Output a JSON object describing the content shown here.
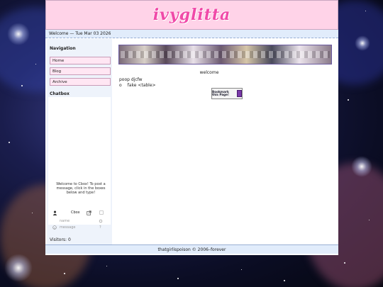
{
  "site": {
    "banner_title": "ivyglitta",
    "welcome": "Welcome — Tue Mar 03 2026",
    "footer": "thatgirlispoison © 2006–forever"
  },
  "sidebar": {
    "nav_heading": "Navigation",
    "nav_items": [
      {
        "label": "Home"
      },
      {
        "label": "Blog"
      },
      {
        "label": "Archive"
      }
    ],
    "chat_heading": "Chatbox",
    "chat_welcome": "Welcome to Cbox! To post a message, click in the boxes below and type!",
    "chat_brand": "Cbox",
    "chat_name_placeholder": "name",
    "chat_message_placeholder": "message",
    "visitors": "Visitors: 0"
  },
  "main": {
    "welcome": "welcome",
    "line1": "poop djcfw",
    "line2_bullet": "o",
    "line2_text": "fake <table>",
    "bookmark_text": "Bookmark this Page!"
  },
  "colors": {
    "banner_bg": "#ffd3e8",
    "title": "#f04aa8",
    "bar_bg": "#e1ecfb",
    "nav_bg": "#ffe6f3"
  }
}
